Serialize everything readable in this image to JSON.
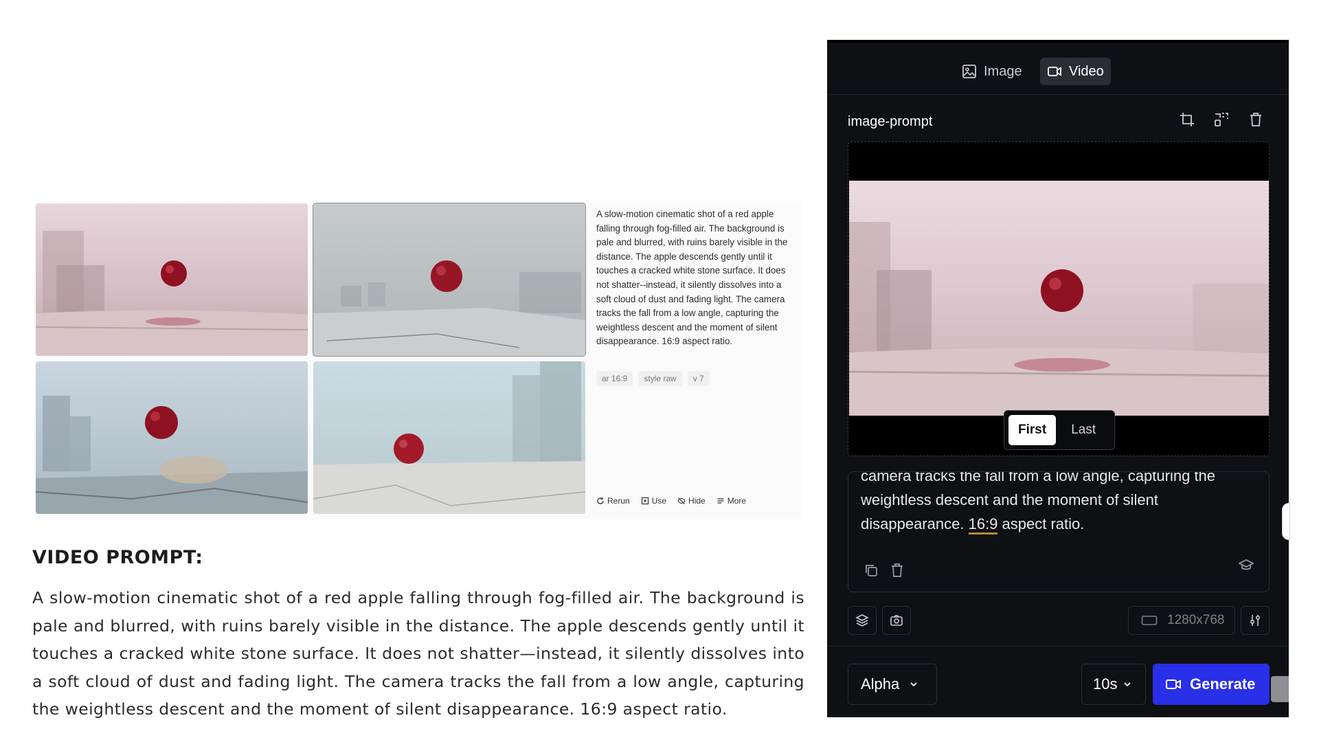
{
  "reference": {
    "prompt_text": "A slow-motion cinematic shot of a red apple falling through fog-filled air. The background is pale and blurred, with ruins barely visible in the distance. The apple descends gently until it touches a cracked white stone surface. It does not shatter--instead, it silently dissolves into a soft cloud of dust and fading light. The camera tracks the fall from a low angle, capturing the weightless descent and the moment of silent disappearance. 16:9 aspect ratio.",
    "chips": [
      "ar 16:9",
      "style raw",
      "v 7"
    ],
    "actions": [
      {
        "label": "Rerun",
        "icon": "rerun-icon"
      },
      {
        "label": "Use",
        "icon": "use-icon"
      },
      {
        "label": "Hide",
        "icon": "hide-icon"
      },
      {
        "label": "More",
        "icon": "more-icon"
      }
    ]
  },
  "video_prompt": {
    "heading": "VIDEO PROMPT:",
    "body": "A slow-motion cinematic shot of a red apple falling through fog-filled air. The background is pale and blurred, with ruins barely visible in the distance. The apple descends gently until it touches a cracked white stone surface. It does not shatter—instead, it silently dissolves into a soft cloud of dust and fading light. The camera tracks the fall from a low angle, capturing the weightless descent and the moment of silent disappearance. 16:9 aspect ratio."
  },
  "panel": {
    "tabs": [
      {
        "label": "Image",
        "icon": "image-icon",
        "active": false
      },
      {
        "label": "Video",
        "icon": "video-camera-icon",
        "active": true
      }
    ],
    "section_title": "image-prompt",
    "section_icons": [
      "crop-icon",
      "scan-icon",
      "trash-icon"
    ],
    "frame_toggle": {
      "first": "First",
      "last": "Last",
      "selected": "First"
    },
    "prompt": {
      "line1": "camera tracks the fall from a low angle, capturing the",
      "line2": "weightless descent and the moment of silent",
      "line3_before": "disappearance.",
      "line3_highlight": "16:9",
      "line3_after": "aspect ratio."
    },
    "resolution": "1280x768",
    "model": "Alpha",
    "duration": "10s",
    "generate": "Generate",
    "colors": {
      "background": "#0e1013",
      "accent": "#2a2fe8",
      "highlight": "#b08d3a"
    }
  }
}
